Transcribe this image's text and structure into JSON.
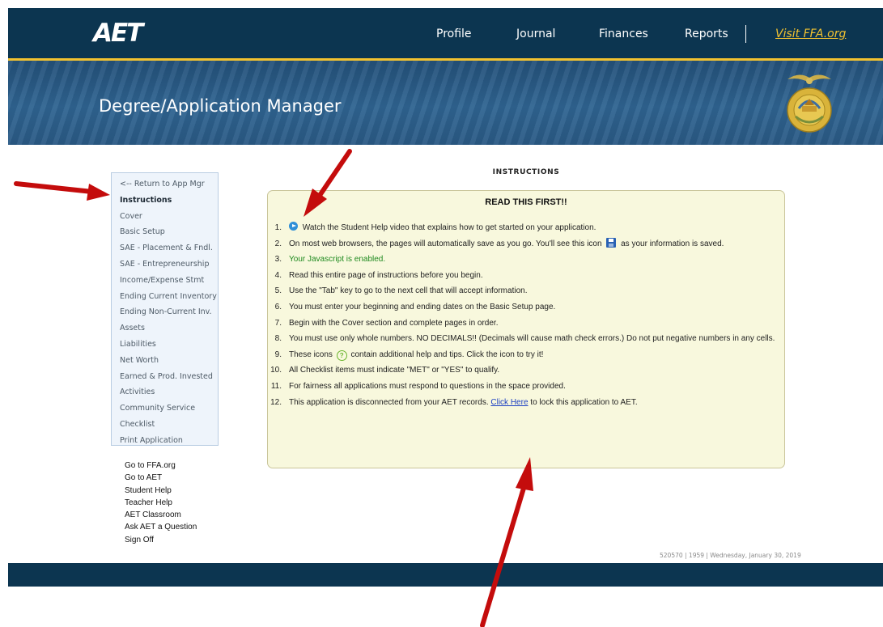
{
  "header": {
    "logo": "AET",
    "nav": [
      "Profile",
      "Journal",
      "Finances",
      "Reports"
    ],
    "visit_link": "Visit FFA.org"
  },
  "banner": {
    "title": "Degree/Application Manager",
    "emblem_icon": "ffa-emblem-icon"
  },
  "sidebar": {
    "items": [
      "<-- Return to App Mgr",
      "Instructions",
      "Cover",
      "Basic Setup",
      "SAE - Placement & Fndl.",
      "SAE - Entrepreneurship",
      "Income/Expense Stmt",
      "Ending Current Inventory",
      "Ending Non-Current Inv.",
      "Assets",
      "Liabilities",
      "Net Worth",
      "Earned & Prod. Invested",
      "Activities",
      "Community Service",
      "Checklist",
      "Print Application"
    ],
    "active": "Instructions"
  },
  "links": [
    "Go to FFA.org",
    "Go to AET",
    "Student Help",
    "Teacher Help",
    "AET Classroom",
    "Ask AET a Question",
    "Sign Off"
  ],
  "main": {
    "heading": "INSTRUCTIONS",
    "box_title": "READ THIS FIRST!!",
    "items": [
      {
        "n": "1.",
        "text": "Watch the Student Help video that explains how to get started on your application."
      },
      {
        "n": "2.",
        "before": "On most web browsers, the pages will automatically save as you go. You'll see this icon",
        "after": "as your information is saved."
      },
      {
        "n": "3.",
        "text": "Your Javascript is enabled."
      },
      {
        "n": "4.",
        "text": "Read this entire page of instructions before you begin."
      },
      {
        "n": "5.",
        "text": "Use the \"Tab\" key to go to the next cell that will accept information."
      },
      {
        "n": "6.",
        "text": "You must enter your beginning and ending dates on the Basic Setup page."
      },
      {
        "n": "7.",
        "text": "Begin with the Cover section and complete pages in order."
      },
      {
        "n": "8.",
        "text": "You must use only whole numbers. NO DECIMALS!! (Decimals will cause math check errors.) Do not put negative numbers in any cells."
      },
      {
        "n": "9.",
        "before": "These icons",
        "after": "contain additional help and tips. Click the icon to try it!"
      },
      {
        "n": "10.",
        "text": "All Checklist items must indicate \"MET\" or \"YES\" to qualify."
      },
      {
        "n": "11.",
        "text": "For fairness all applications must respond to questions in the space provided."
      },
      {
        "n": "12.",
        "before": "This application is disconnected from your AET records.",
        "link": "Click Here",
        "after": "to lock this application to AET."
      }
    ]
  },
  "footer": {
    "meta": "520570 | 1959 | Wednesday, January 30, 2019"
  },
  "colors": {
    "navy": "#0c3550",
    "gold": "#f2c230",
    "arrow": "#c40c0c",
    "note_bg": "#f8f8dd",
    "ok_green": "#1f8a1f",
    "link_blue": "#1b3fc2"
  }
}
